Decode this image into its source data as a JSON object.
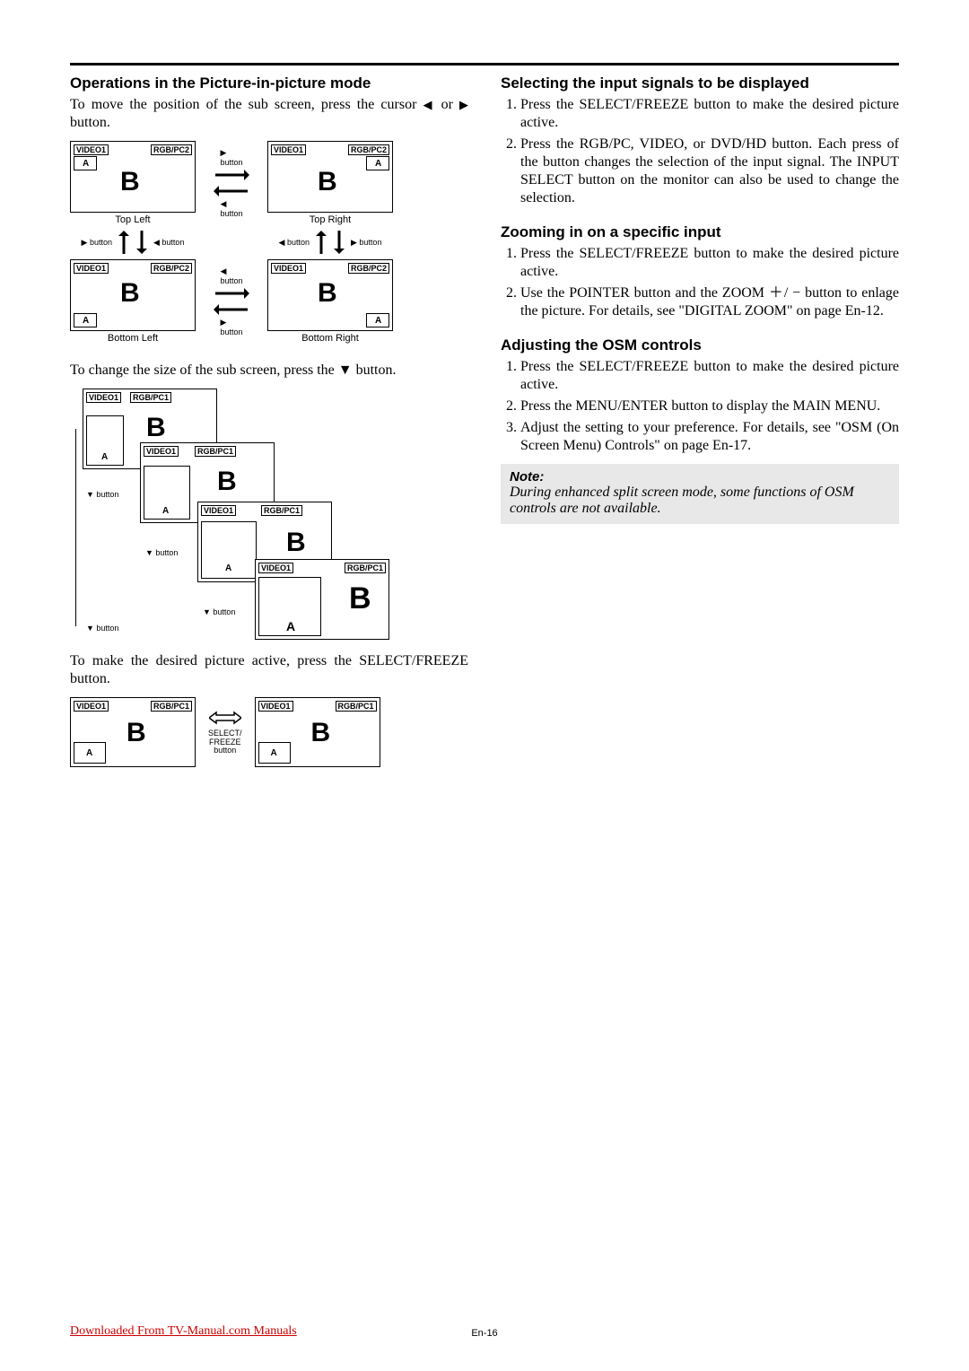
{
  "rule": true,
  "left": {
    "h1": "Operations in the Picture-in-picture mode",
    "p1_a": "To move the position of the sub screen, press the cursor ",
    "p1_b": " or ",
    "p1_c": " button.",
    "d1": {
      "tl": {
        "v": "VIDEO1",
        "r": "RGB/PC2",
        "a": "A",
        "b": "B",
        "cap": "Top Left"
      },
      "tr": {
        "v": "VIDEO1",
        "r": "RGB/PC2",
        "a": "A",
        "b": "B",
        "cap": "Top Right"
      },
      "bl": {
        "v": "VIDEO1",
        "r": "RGB/PC2",
        "a": "A",
        "b": "B",
        "cap": "Bottom Left"
      },
      "br": {
        "v": "VIDEO1",
        "r": "RGB/PC2",
        "a": "A",
        "b": "B",
        "cap": "Bottom Right"
      },
      "btn_right": "▶ button",
      "btn_left": "◀ button",
      "row_left": "▶ button",
      "row_left2": "◀ button",
      "row_right": "◀ button",
      "row_right2": "▶ button"
    },
    "p2": "To change the size of the sub screen, press the ▼ button.",
    "d2": {
      "v": "VIDEO1",
      "r": "RGB/PC1",
      "a": "A",
      "b": "B",
      "lbl": "▼ button"
    },
    "p3": "To make the desired picture active, press the SELECT/FREEZE button.",
    "d3": {
      "left": {
        "v": "VIDEO1",
        "r": "RGB/PC1",
        "a": "A",
        "b": "B"
      },
      "right": {
        "v": "VIDEO1",
        "r": "RGB/PC1",
        "a": "A",
        "b": "B"
      },
      "mid1": "SELECT/",
      "mid2": "FREEZE",
      "mid3": "button"
    }
  },
  "right": {
    "h1": "Selecting the input signals to be displayed",
    "ol1": [
      "Press the SELECT/FREEZE button to make the desired picture active.",
      "Press the RGB/PC, VIDEO, or DVD/HD button. Each press of the button changes the selection of the input signal. The INPUT SELECT button on the monitor can also be used to change the selection."
    ],
    "h2": "Zooming in on a specific input",
    "ol2": [
      "Press the SELECT/FREEZE button to make the desired picture active.",
      "Use the POINTER button and the ZOOM ＋/ − button to enlage the picture. For details, see \"DIGITAL ZOOM\" on page En-12."
    ],
    "h3": "Adjusting the OSM controls",
    "ol3": [
      "Press the SELECT/FREEZE button to make the desired picture active.",
      "Press the MENU/ENTER button to display the MAIN MENU.",
      "Adjust the setting to your preference. For details, see \"OSM (On Screen Menu) Controls\" on page En-17."
    ],
    "note_title": "Note:",
    "note_body": "During enhanced split screen mode, some functions of OSM controls are not available."
  },
  "footer": {
    "left": "Downloaded From TV-Manual.com Manuals",
    "center": "En-16"
  }
}
